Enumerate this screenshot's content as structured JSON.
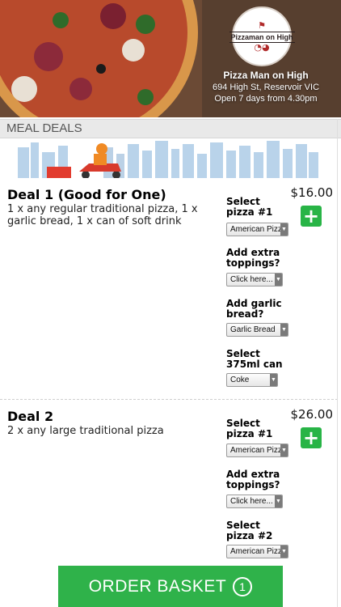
{
  "store": {
    "logo_text": "Pizzaman on High",
    "name": "Pizza Man on High",
    "address": "694 High St, Reservoir VIC",
    "hours": "Open 7 days from 4.30pm"
  },
  "section": {
    "title": "MEAL DEALS"
  },
  "deals": [
    {
      "title": "Deal 1 (Good for One)",
      "description": "1 x any regular traditional pizza, 1 x garlic bread, 1 x can of soft drink",
      "price": "$16.00",
      "add_label": "+",
      "options": [
        {
          "label": "Select pizza #1",
          "value": "American Pizza"
        },
        {
          "label": "Add extra toppings?",
          "value": "Click here..."
        },
        {
          "label": "Add garlic bread?",
          "value": "Garlic Bread"
        },
        {
          "label": "Select 375ml can",
          "value": "Coke"
        }
      ]
    },
    {
      "title": "Deal 2",
      "description": "2 x any large traditional pizza",
      "price": "$26.00",
      "add_label": "+",
      "options": [
        {
          "label": "Select pizza #1",
          "value": "American Pizza"
        },
        {
          "label": "Add extra toppings?",
          "value": "Click here..."
        },
        {
          "label": "Select pizza #2",
          "value": "American Pizza"
        }
      ]
    }
  ],
  "order": {
    "label": "ORDER BASKET",
    "count": "1"
  },
  "colors": {
    "accent_green": "#2fb24a",
    "add_green": "#28b446",
    "section_gray": "#e9e9e9"
  },
  "icons": {
    "add": "plus-icon",
    "dropdown": "triangle-down-icon"
  }
}
